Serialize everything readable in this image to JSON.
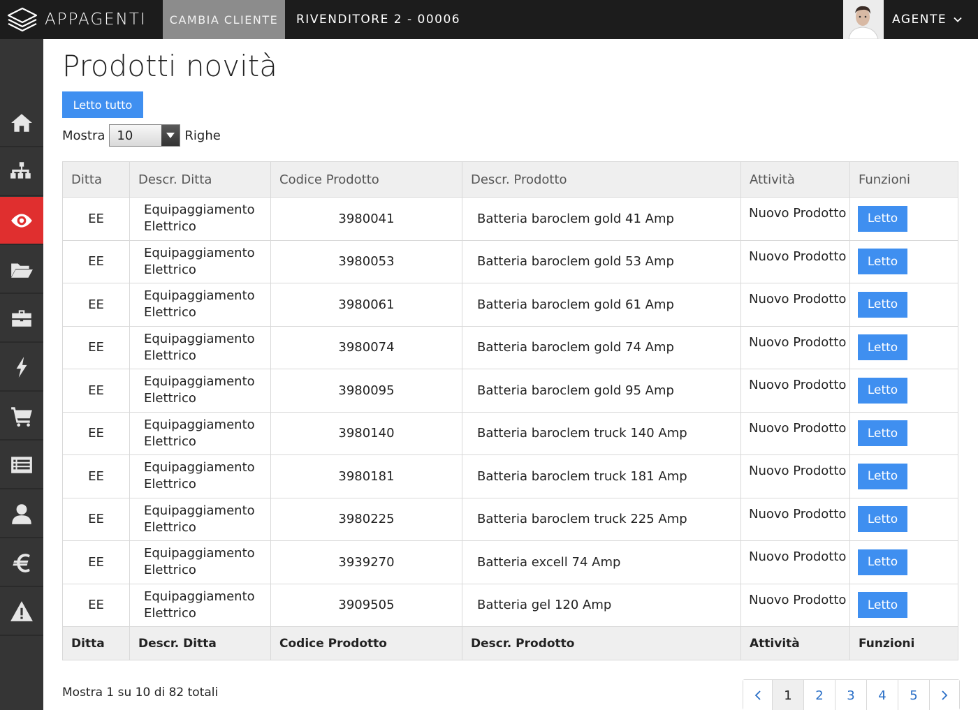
{
  "header": {
    "brand": "APPAGENTI",
    "cambia_cliente": "CAMBIA CLIENTE",
    "rivenditore": "RIVENDITORE 2 - 00006",
    "user": "AGENTE"
  },
  "sidebar": {
    "items": [
      {
        "icon": "home-icon"
      },
      {
        "icon": "sitemap-icon"
      },
      {
        "icon": "eye-icon",
        "active": true
      },
      {
        "icon": "folder-open-icon"
      },
      {
        "icon": "briefcase-icon"
      },
      {
        "icon": "bolt-icon"
      },
      {
        "icon": "cart-icon"
      },
      {
        "icon": "list-icon"
      },
      {
        "icon": "user-icon"
      },
      {
        "icon": "euro-icon"
      },
      {
        "icon": "warning-icon"
      }
    ],
    "active_color": "#e02f2f"
  },
  "main": {
    "title": "Prodotti novità",
    "letto_tutto": "Letto tutto",
    "mostra_label": "Mostra",
    "rows_value": "10",
    "righe_label": "Righe"
  },
  "table": {
    "columns": [
      "Ditta",
      "Descr. Ditta",
      "Codice Prodotto",
      "Descr. Prodotto",
      "Attività",
      "Funzioni"
    ],
    "rows": [
      {
        "ditta": "EE",
        "descr_ditta": "Equipaggiamento Elettrico",
        "codice": "3980041",
        "descr_prodotto": "Batteria baroclem gold 41 Amp",
        "attivita": "Nuovo Prodotto",
        "funzione": "Letto"
      },
      {
        "ditta": "EE",
        "descr_ditta": "Equipaggiamento Elettrico",
        "codice": "3980053",
        "descr_prodotto": "Batteria baroclem gold 53 Amp",
        "attivita": "Nuovo Prodotto",
        "funzione": "Letto"
      },
      {
        "ditta": "EE",
        "descr_ditta": "Equipaggiamento Elettrico",
        "codice": "3980061",
        "descr_prodotto": "Batteria baroclem gold 61 Amp",
        "attivita": "Nuovo Prodotto",
        "funzione": "Letto"
      },
      {
        "ditta": "EE",
        "descr_ditta": "Equipaggiamento Elettrico",
        "codice": "3980074",
        "descr_prodotto": "Batteria baroclem gold 74 Amp",
        "attivita": "Nuovo Prodotto",
        "funzione": "Letto"
      },
      {
        "ditta": "EE",
        "descr_ditta": "Equipaggiamento Elettrico",
        "codice": "3980095",
        "descr_prodotto": "Batteria baroclem gold 95 Amp",
        "attivita": "Nuovo Prodotto",
        "funzione": "Letto"
      },
      {
        "ditta": "EE",
        "descr_ditta": "Equipaggiamento Elettrico",
        "codice": "3980140",
        "descr_prodotto": "Batteria baroclem truck 140 Amp",
        "attivita": "Nuovo Prodotto",
        "funzione": "Letto"
      },
      {
        "ditta": "EE",
        "descr_ditta": "Equipaggiamento Elettrico",
        "codice": "3980181",
        "descr_prodotto": "Batteria baroclem truck 181 Amp",
        "attivita": "Nuovo Prodotto",
        "funzione": "Letto"
      },
      {
        "ditta": "EE",
        "descr_ditta": "Equipaggiamento Elettrico",
        "codice": "3980225",
        "descr_prodotto": "Batteria baroclem truck  225 Amp",
        "attivita": "Nuovo Prodotto",
        "funzione": "Letto"
      },
      {
        "ditta": "EE",
        "descr_ditta": "Equipaggiamento Elettrico",
        "codice": "3939270",
        "descr_prodotto": "Batteria excell 74 Amp",
        "attivita": "Nuovo Prodotto",
        "funzione": "Letto"
      },
      {
        "ditta": "EE",
        "descr_ditta": "Equipaggiamento Elettrico",
        "codice": "3909505",
        "descr_prodotto": "Batteria gel 120 Amp",
        "attivita": "Nuovo Prodotto",
        "funzione": "Letto"
      }
    ]
  },
  "footer": {
    "info": "Mostra 1 su 10 di 82 totali",
    "pages": [
      "1",
      "2",
      "3",
      "4",
      "5"
    ],
    "current_page": "1"
  },
  "colors": {
    "primary": "#3f8ff0",
    "topbar": "#1c1c1c",
    "sidebar": "#353535"
  }
}
